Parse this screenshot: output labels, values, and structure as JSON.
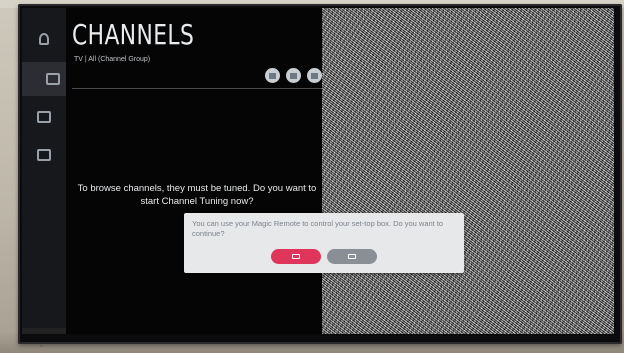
{
  "screen": {
    "title": "CHANNELS",
    "subtitle": "TV | All (Channel Group)",
    "message": "To browse channels, they must be tuned. Do you want to start Channel Tuning now?"
  },
  "rail": {
    "items": [
      {
        "icon": "user-icon"
      },
      {
        "icon": "tv-icon"
      },
      {
        "icon": "monitor-icon"
      },
      {
        "icon": "media-icon"
      }
    ]
  },
  "toolbar": {
    "buttons": [
      {
        "icon": "tv-icon"
      },
      {
        "icon": "list-icon"
      },
      {
        "icon": "grid-icon"
      }
    ]
  },
  "dialog": {
    "text": "You can use your Magic Remote to control your set-top box. Do you want to continue?",
    "primary_icon": "ok-icon",
    "secondary_icon": "cancel-icon"
  },
  "colors": {
    "accent": "#e0355a",
    "panel_bg": "#050505",
    "rail_bg": "#17181c",
    "dialog_bg": "#e6e8ea"
  }
}
